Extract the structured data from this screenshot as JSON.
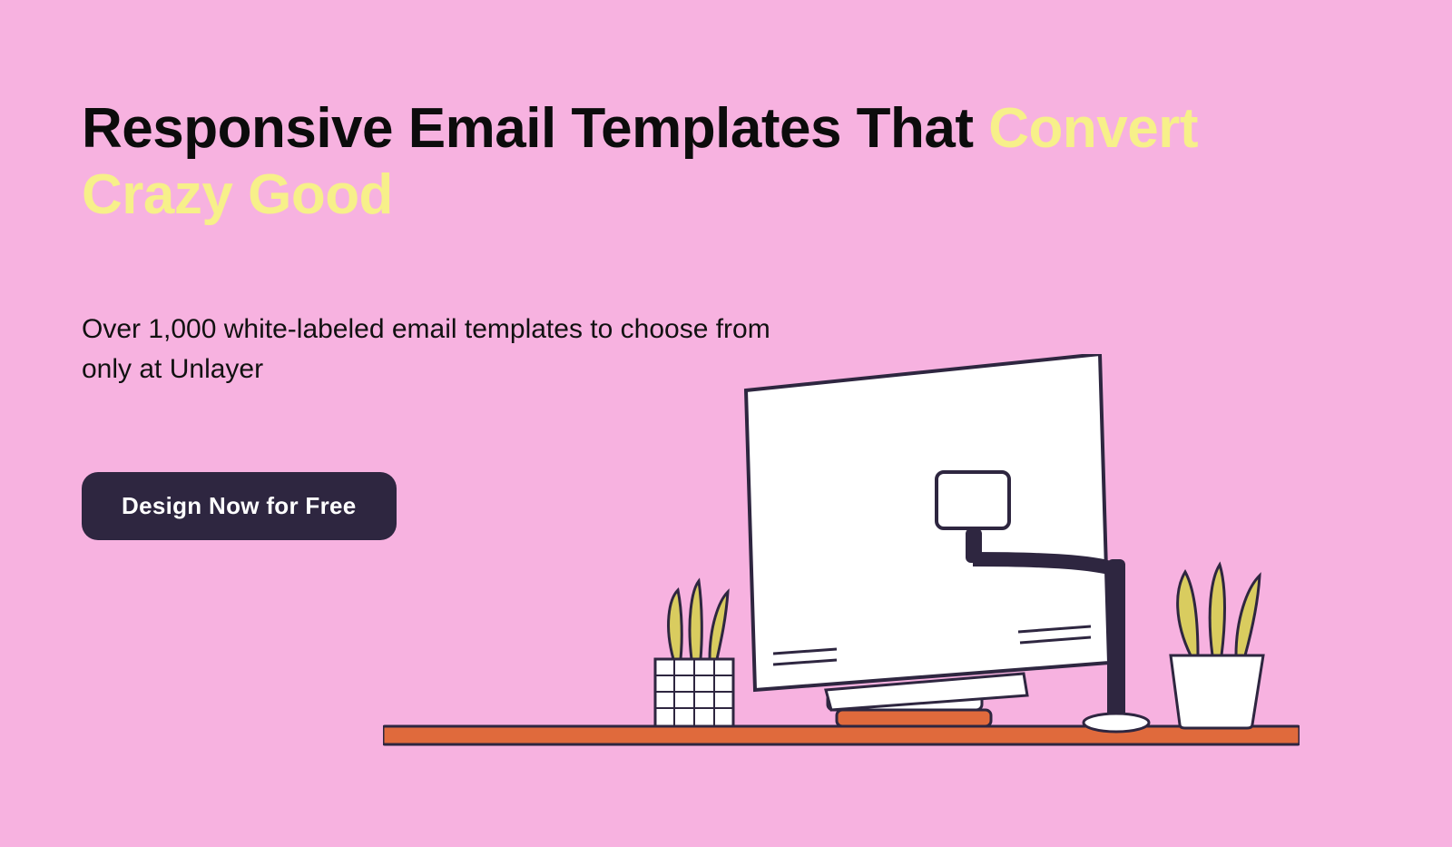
{
  "hero": {
    "headline_plain": "Responsive Email Templates That ",
    "headline_accent": "Convert Crazy Good",
    "subhead": "Over 1,000 white-labeled email templates to choose from only at Unlayer",
    "cta_label": "Design Now for Free"
  },
  "colors": {
    "bg": "#f7b2e0",
    "accent_text": "#f7f08a",
    "button_bg": "#2e2640",
    "ink": "#0c0c0c"
  }
}
